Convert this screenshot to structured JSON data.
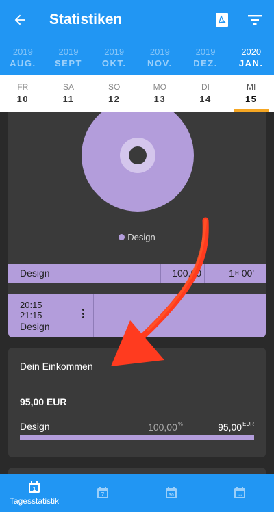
{
  "appbar": {
    "title": "Statistiken",
    "back_icon": "arrow-back-icon",
    "actions": [
      "pdf-icon",
      "filter-icon"
    ]
  },
  "months": [
    {
      "year": "2019",
      "month": "AUG."
    },
    {
      "year": "2019",
      "month": "SEPT"
    },
    {
      "year": "2019",
      "month": "OKT."
    },
    {
      "year": "2019",
      "month": "NOV."
    },
    {
      "year": "2019",
      "month": "DEZ."
    },
    {
      "year": "2020",
      "month": "JAN.",
      "active": true
    }
  ],
  "days": [
    {
      "name": "FR",
      "date": "10"
    },
    {
      "name": "SA",
      "date": "11"
    },
    {
      "name": "SO",
      "date": "12"
    },
    {
      "name": "MO",
      "date": "13"
    },
    {
      "name": "DI",
      "date": "14"
    },
    {
      "name": "MI",
      "date": "15",
      "active": true
    }
  ],
  "chart_data": {
    "type": "pie",
    "categories": [
      "Design"
    ],
    "values": [
      100
    ],
    "colors": [
      "#b39ddb"
    ],
    "legend": [
      "Design"
    ]
  },
  "summary_row": {
    "name": "Design",
    "percent": "100,00",
    "duration": "1",
    "duration_unit": "H",
    "duration_min": "00'"
  },
  "entry": {
    "start": "20:15",
    "end": "21:15",
    "label": "Design"
  },
  "income": {
    "title": "Dein Einkommen",
    "total": "95,00 EUR",
    "item_name": "Design",
    "item_percent": "100,00",
    "percent_sign": "%",
    "item_amount": "95,00",
    "currency": "EUR"
  },
  "bottomnav": {
    "items": [
      {
        "label": "Tagesstatistik",
        "icon": "calendar-day-icon",
        "day": "1"
      },
      {
        "label": "",
        "icon": "calendar-week-icon",
        "day": "7"
      },
      {
        "label": "",
        "icon": "calendar-month-icon",
        "day": "30"
      },
      {
        "label": "",
        "icon": "calendar-custom-icon",
        "day": "..."
      }
    ]
  },
  "colors": {
    "primary": "#2196f3",
    "accent": "#f5a623",
    "category_design": "#b39ddb",
    "card": "#3a3a3a",
    "arrow": "#ff3b1f"
  }
}
